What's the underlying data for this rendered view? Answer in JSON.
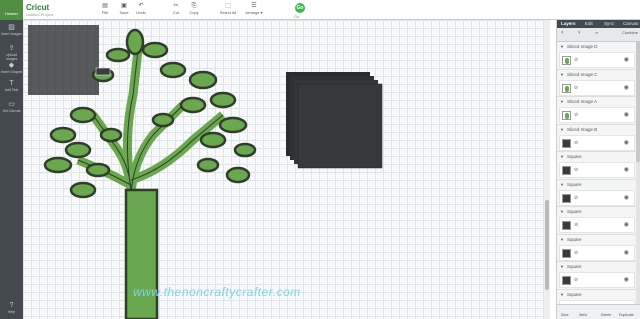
{
  "app": {
    "brand": "Cricut",
    "project": "Untitled Project",
    "menu_label": "Header"
  },
  "toolbar": [
    {
      "label": "File",
      "icon": "folder-icon"
    },
    {
      "label": "Save",
      "icon": "save-icon"
    },
    {
      "label": "Undo",
      "icon": "undo-icon"
    },
    {
      "label": "Cut",
      "icon": "cut-icon"
    },
    {
      "label": "Copy",
      "icon": "copy-icon"
    },
    {
      "label": "Select All",
      "icon": "select-all-icon"
    },
    {
      "label": "Arrange",
      "icon": "arrange-icon"
    }
  ],
  "go": {
    "glyph": "Go",
    "label": "Go"
  },
  "sidebar": [
    {
      "label": "Insert Images",
      "icon": "image-icon"
    },
    {
      "label": "Upload Images",
      "icon": "upload-icon"
    },
    {
      "label": "Insert Shapes",
      "icon": "shapes-icon"
    },
    {
      "label": "Add Text",
      "icon": "text-icon"
    },
    {
      "label": "Set Canvas",
      "icon": "canvas-icon"
    },
    {
      "label": "Help",
      "icon": "help-icon"
    }
  ],
  "canvas": {
    "zoom_controls": "− +",
    "watermark": "www.thenoncraftycrafter.com"
  },
  "panel": {
    "tabs": [
      "Layers",
      "Edit",
      "Sync",
      "Canvas"
    ],
    "combine_label": "Combine",
    "layers": [
      {
        "name": "Sliced Image D",
        "thumb": "tree"
      },
      {
        "name": "Sliced Image C",
        "thumb": "tree"
      },
      {
        "name": "Sliced Image A",
        "thumb": "tree"
      },
      {
        "name": "Sliced Image B",
        "thumb": "dark"
      },
      {
        "name": "Square",
        "thumb": "dark"
      },
      {
        "name": "Square",
        "thumb": "dark"
      },
      {
        "name": "Square",
        "thumb": "dark"
      },
      {
        "name": "Square",
        "thumb": "dark"
      },
      {
        "name": "Square",
        "thumb": "dark"
      },
      {
        "name": "Square",
        "thumb": "dark"
      }
    ],
    "footer": [
      "Slice",
      "Weld",
      "Delete",
      "Duplicate"
    ]
  },
  "colors": {
    "tree_fill": "#6aa84f",
    "tree_stroke": "#2f3d2a",
    "square_fill": "#3b3d40",
    "accent": "#3dbb4e"
  }
}
